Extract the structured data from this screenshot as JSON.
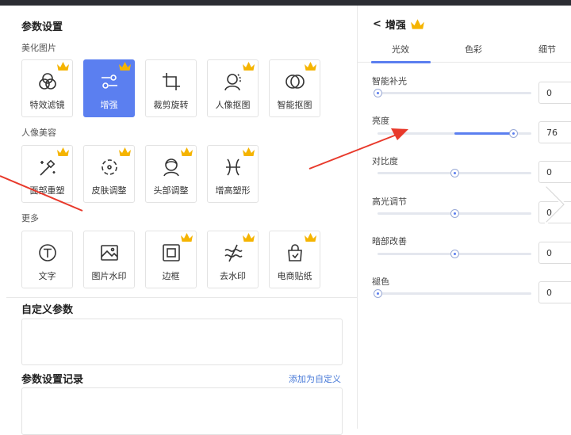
{
  "left": {
    "title": "参数设置",
    "sections": [
      {
        "label": "美化图片",
        "tiles": [
          {
            "label": "特效滤镜",
            "icon": "filter-circles-icon",
            "crown": true,
            "active": false
          },
          {
            "label": "增强",
            "icon": "adjust-sliders-icon",
            "crown": true,
            "active": true
          },
          {
            "label": "裁剪旋转",
            "icon": "crop-icon",
            "crown": false,
            "active": false
          },
          {
            "label": "人像抠图",
            "icon": "portrait-cutout-icon",
            "crown": true,
            "active": false
          },
          {
            "label": "智能抠图",
            "icon": "smart-cutout-icon",
            "crown": true,
            "active": false
          }
        ]
      },
      {
        "label": "人像美容",
        "tiles": [
          {
            "label": "面部重塑",
            "icon": "magic-wand-icon",
            "crown": true,
            "active": false
          },
          {
            "label": "皮肤调整",
            "icon": "skin-adjust-icon",
            "crown": true,
            "active": false
          },
          {
            "label": "头部调整",
            "icon": "head-adjust-icon",
            "crown": true,
            "active": false
          },
          {
            "label": "增高塑形",
            "icon": "body-shape-icon",
            "crown": true,
            "active": false
          }
        ]
      },
      {
        "label": "更多",
        "tiles": [
          {
            "label": "文字",
            "icon": "text-icon",
            "crown": false,
            "active": false
          },
          {
            "label": "图片水印",
            "icon": "image-watermark-icon",
            "crown": false,
            "active": false
          },
          {
            "label": "边框",
            "icon": "border-icon",
            "crown": true,
            "active": false
          },
          {
            "label": "去水印",
            "icon": "remove-watermark-icon",
            "crown": true,
            "active": false
          },
          {
            "label": "电商贴纸",
            "icon": "shop-sticker-icon",
            "crown": true,
            "active": false
          }
        ]
      }
    ],
    "custom_params_title": "自定义参数",
    "history_title": "参数设置记录",
    "add_custom_link": "添加为自定义"
  },
  "right": {
    "back_glyph": "<",
    "title": "增强",
    "tabs": [
      {
        "label": "光效",
        "active": true
      },
      {
        "label": "色彩",
        "active": false
      },
      {
        "label": "细节",
        "active": false
      }
    ],
    "params": [
      {
        "label": "智能补光",
        "value": "0",
        "level": 0
      },
      {
        "label": "亮度",
        "value": "76",
        "level": 0.88,
        "fill_from": 0.5
      },
      {
        "label": "对比度",
        "value": "0",
        "level": 0.5
      },
      {
        "label": "高光调节",
        "value": "0",
        "level": 0.5
      },
      {
        "label": "暗部改善",
        "value": "0",
        "level": 0.5
      },
      {
        "label": "褪色",
        "value": "0",
        "level": 0
      }
    ]
  },
  "colors": {
    "accent": "#5b7ff0",
    "crown": "#f5b400",
    "arrow": "#e8392b"
  }
}
